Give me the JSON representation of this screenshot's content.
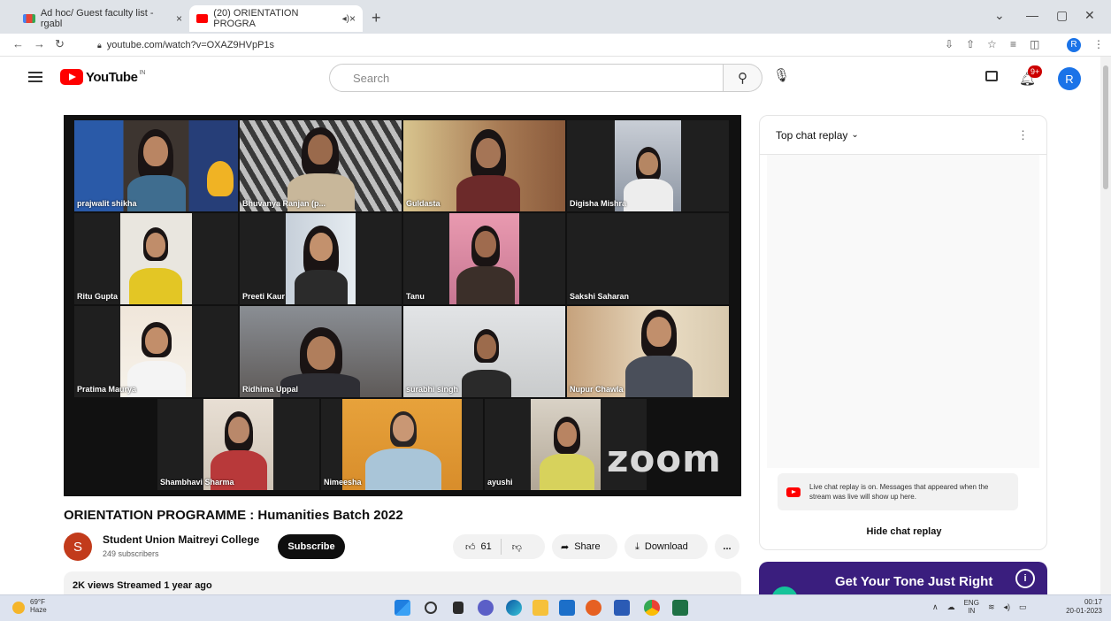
{
  "browser": {
    "tabs": [
      {
        "label": "Ad hoc/ Guest faculty list - rgabl",
        "close": "×"
      },
      {
        "label": "(20) ORIENTATION PROGRA",
        "close": "×"
      }
    ],
    "new_tab": "+",
    "url": "youtube.com/watch?v=OXAZ9HVpP1s",
    "profile_initial": "R"
  },
  "youtube": {
    "logo_text": "YouTube",
    "country_code": "IN",
    "search_placeholder": "Search",
    "notifications_badge": "9+",
    "avatar_initial": "R"
  },
  "video": {
    "participants": [
      "prajwalit shikha",
      "Bhuvanya Ranjan (p...",
      "Guldasta",
      "Digisha Mishra",
      "Ritu Gupta",
      "Preeti Kaur",
      "Tanu",
      "Sakshi Saharan",
      "Pratima Maurya",
      "Ridhima Uppal",
      "surabhi singh",
      "Nupur Chawla",
      "Shambhavi Sharma",
      "Nimeesha",
      "ayushi"
    ],
    "watermark": "zoom",
    "title": "ORIENTATION PROGRAMME : Humanities Batch 2022"
  },
  "channel": {
    "initial": "S",
    "name": "Student Union Maitreyi College",
    "subscribers": "249 subscribers",
    "subscribe_label": "Subscribe"
  },
  "actions": {
    "likes": "61",
    "share": "Share",
    "download": "Download",
    "more": "..."
  },
  "description": {
    "meta": "2K views  Streamed 1 year ago"
  },
  "chat": {
    "header": "Top chat replay",
    "note": "Live chat replay is on. Messages that appeared when the stream was live will show up here.",
    "hide_label": "Hide chat replay"
  },
  "ad": {
    "text": "Get Your Tone Just Right"
  },
  "taskbar": {
    "temperature": "69°F",
    "condition": "Haze",
    "lang": "ENG",
    "region": "IN",
    "time": "00:17",
    "date": "20-01-2023"
  }
}
